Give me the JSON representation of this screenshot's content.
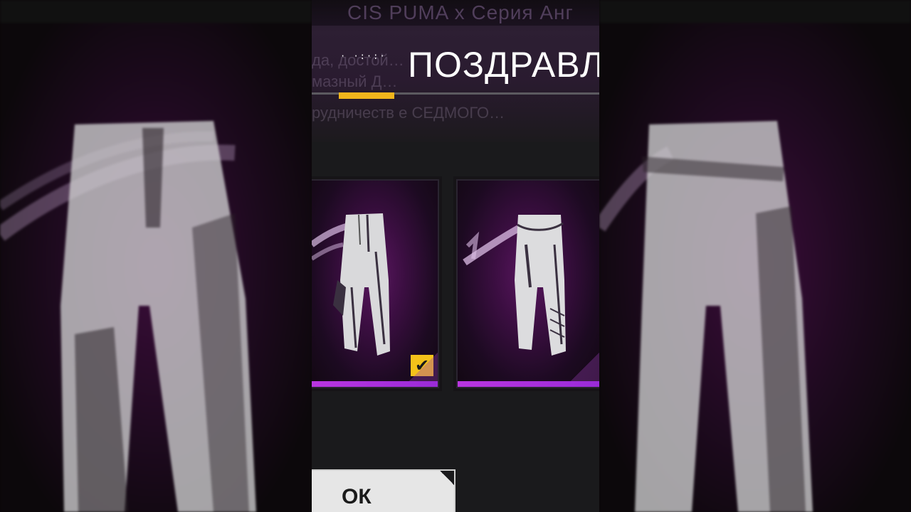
{
  "dialog": {
    "background_title": "CIS PUMA x Серия Анг",
    "headline": "ПОЗДРАВЛЯ",
    "faded_line_1": "да,  достой…",
    "faded_line_2": "мазный  Д…",
    "faded_line_3": "рудничеств е СЕДМОГО…",
    "dots_glyph": "· ·:·:·"
  },
  "rewards": [
    {
      "name": "white-cargo-pants",
      "selected": true,
      "check_glyph": "✔"
    },
    {
      "name": "white-jogger-pants",
      "selected": false
    }
  ],
  "buttons": {
    "ok_label": "ОК"
  },
  "colors": {
    "accent_yellow": "#f2b51c",
    "card_purple_bar": "#b935e0",
    "headline": "#ffffff"
  }
}
